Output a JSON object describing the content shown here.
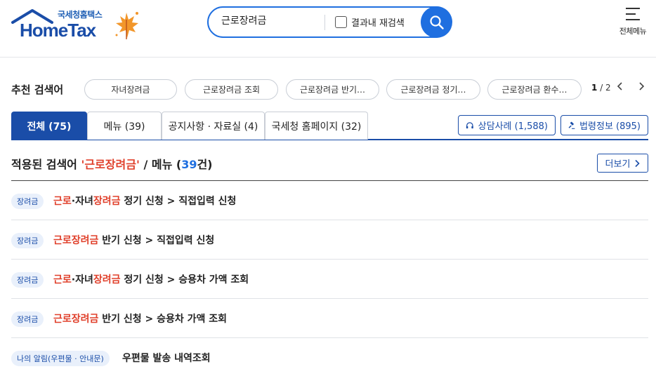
{
  "header": {
    "logo_sub": "국세청홈택스",
    "logo_main": "HomeTax",
    "search_value": "근로장려금",
    "recheck_label": "결과내 재검색",
    "menu_label": "전체메뉴"
  },
  "recommend": {
    "title": "추천 검색어",
    "chips": [
      "자녀장려금",
      "근로장려금 조회",
      "근로장려금 반기…",
      "근로장려금 정기…",
      "근로장려금 환수…"
    ],
    "page_current": "1",
    "page_total": "/ 2"
  },
  "tabs": [
    {
      "label": "전체 (75)"
    },
    {
      "label": "메뉴 (39)"
    },
    {
      "label": "공지사항 · 자료실 (4)"
    },
    {
      "label": "국세청 홈페이지 (32)"
    }
  ],
  "side_buttons": {
    "consult": "상담사례 (1,588)",
    "law": "법령정보 (895)"
  },
  "section": {
    "prefix": "적용된 검색어 ",
    "keyword": "'근로장려금'",
    "middle": " / 메뉴 (",
    "count": "39",
    "suffix": "건)",
    "more_label": "더보기"
  },
  "results": [
    {
      "badge": "장려금",
      "h1": "근로",
      "t1": "·자녀",
      "h2": "장려금",
      "t2": " 정기 신청 > 직접입력 신청"
    },
    {
      "badge": "장려금",
      "h1": "근로장려금",
      "t1": " 반기 신청 > 직접입력 신청",
      "h2": "",
      "t2": ""
    },
    {
      "badge": "장려금",
      "h1": "근로",
      "t1": "·자녀",
      "h2": "장려금",
      "t2": " 정기 신청 > 승용차 가액 조회"
    },
    {
      "badge": "장려금",
      "h1": "근로장려금",
      "t1": " 반기 신청 > 승용차 가액 조회",
      "h2": "",
      "t2": ""
    },
    {
      "badge": "나의 알림(우편물 · 안내문)",
      "h1": "",
      "t1": "우편물 발송 내역조회",
      "h2": "",
      "t2": ""
    }
  ],
  "colors": {
    "brand_blue": "#1a4da8",
    "accent_blue": "#1f6fe0",
    "highlight_red": "#e0402b"
  }
}
